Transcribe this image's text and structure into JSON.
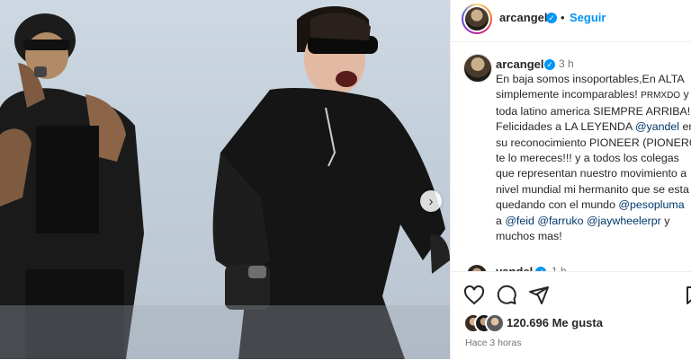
{
  "header": {
    "username": "arcangel",
    "dot": "•",
    "follow_label": "Seguir"
  },
  "caption": {
    "username": "arcangel",
    "time": "3 h",
    "lines": [
      "En baja somos insoportables,En ALTA",
      "simplemente incomparables!",
      "PRMXDO",
      " y",
      "toda latino america SIEMPRE ARRIBA!",
      "Felicidades a LA LEYENDA ",
      "@yandel",
      " en",
      "su reconocimiento PIONEER (PIONERO)",
      "te lo mereces!!! y a todos los colegas",
      "que representan nuestro movimiento a",
      "nivel mundial mi hermanito que se esta",
      "quedando con el mundo ",
      "@pesopluma",
      "a ",
      "@feid",
      "@farruko",
      "@jaywheelerpr",
      " y",
      "muchos mas!"
    ]
  },
  "next_comment": {
    "username": "yandel",
    "time": "1 h"
  },
  "footer": {
    "likes": "120.696 Me gusta",
    "ago": "Hace 3 horas"
  },
  "icons": [
    "heart-icon",
    "comment-icon",
    "share-icon",
    "bookmark-icon",
    "verified-icon",
    "chevron-right-icon"
  ]
}
